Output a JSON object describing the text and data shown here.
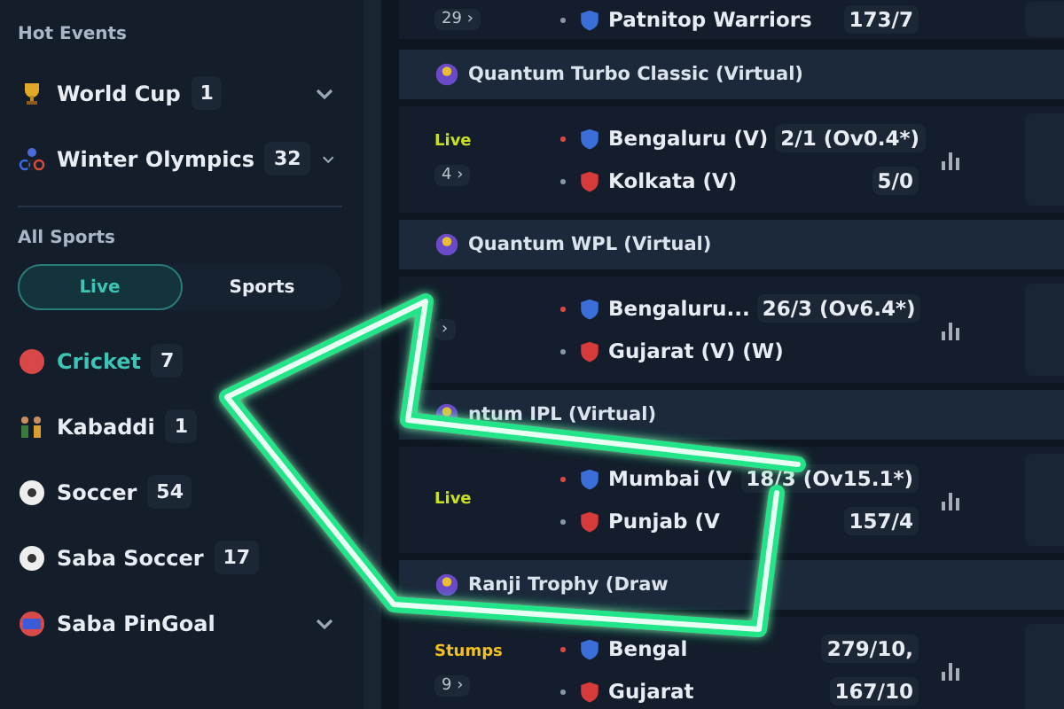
{
  "sidebar": {
    "hot_events_title": "Hot Events",
    "hot_events": [
      {
        "name": "World Cup",
        "count": "1",
        "expandable": true
      },
      {
        "name": "Winter Olympics",
        "count": "32",
        "expandable": true
      }
    ],
    "all_sports_title": "All Sports",
    "toggle": [
      {
        "label": "Live",
        "selected": true
      },
      {
        "label": "Sports",
        "selected": false
      }
    ],
    "sports": [
      {
        "name": "Cricket",
        "count": "7",
        "selected": true,
        "expandable": false
      },
      {
        "name": "Kabaddi",
        "count": "1",
        "selected": false,
        "expandable": false
      },
      {
        "name": "Soccer",
        "count": "54",
        "selected": false,
        "expandable": false
      },
      {
        "name": "Saba Soccer",
        "count": "17",
        "selected": false,
        "expandable": false
      },
      {
        "name": "Saba PinGoal",
        "selected": false,
        "expandable": true
      }
    ]
  },
  "events": [
    {
      "kind": "match",
      "more": "29 ›",
      "teams": [
        {
          "name": "Patnitop Warriors",
          "score": "173/7",
          "serving": false
        }
      ]
    },
    {
      "kind": "header",
      "title": "Quantum Turbo Classic (Virtual)"
    },
    {
      "kind": "match",
      "status": "Live",
      "more": "4 ›",
      "teams": [
        {
          "name": "Bengaluru (V)",
          "score": "2/1 (Ov0.4*)",
          "serving": true
        },
        {
          "name": "Kolkata (V)",
          "score": "5/0",
          "serving": false
        }
      ]
    },
    {
      "kind": "header",
      "title": "Quantum WPL (Virtual)"
    },
    {
      "kind": "match",
      "more": "›",
      "teams": [
        {
          "name": "Bengaluru...",
          "score": "26/3 (Ov6.4*)",
          "serving": true
        },
        {
          "name": "Gujarat (V) (W)",
          "serving": false
        }
      ]
    },
    {
      "kind": "header",
      "title": "ntum IPL (Virtual)"
    },
    {
      "kind": "match",
      "status": "Live",
      "teams": [
        {
          "name": "Mumbai (V",
          "score": "18/3 (Ov15.1*)",
          "serving": true
        },
        {
          "name": "Punjab (V",
          "score": "157/4",
          "serving": false
        }
      ]
    },
    {
      "kind": "header",
      "title": "Ranji Trophy (Draw"
    },
    {
      "kind": "match",
      "status": "Stumps",
      "more": "9 ›",
      "teams": [
        {
          "name": "Bengal",
          "score": "279/10,",
          "serving": true
        },
        {
          "name": "Gujarat",
          "score": "167/10",
          "serving": false
        }
      ]
    }
  ]
}
